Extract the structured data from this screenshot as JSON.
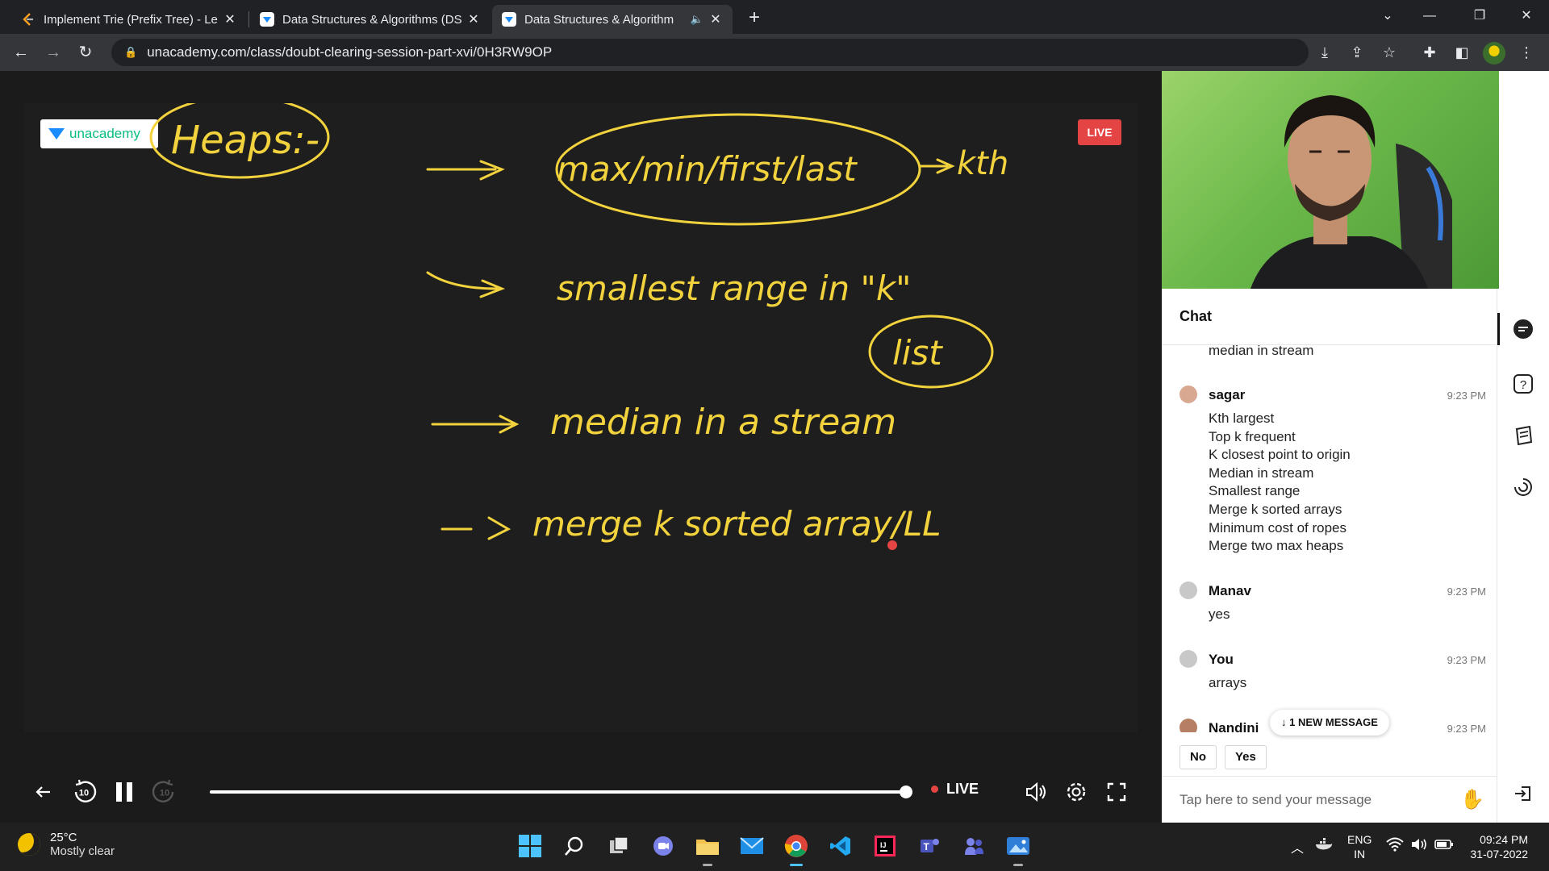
{
  "browser": {
    "tabs": [
      {
        "title": "Implement Trie (Prefix Tree) - Lee",
        "active": false
      },
      {
        "title": "Data Structures & Algorithms (DS",
        "active": false
      },
      {
        "title": "Data Structures & Algorithm",
        "active": true
      }
    ],
    "url": "unacademy.com/class/doubt-clearing-session-part-xvi/0H3RW9OP"
  },
  "player": {
    "brand": "unacademy",
    "live_badge": "LIVE",
    "live_label": "LIVE",
    "rewind_label": "10",
    "forward_label": "10",
    "progress": 1.0,
    "whiteboard_notes": [
      "Heaps:-",
      "max/min/first/last",
      "kth",
      "smallest range in \"k\"",
      "list",
      "median in a stream",
      "merge k sorted array/LL"
    ]
  },
  "chat": {
    "title": "Chat",
    "partial_top": "median in stream",
    "messages": [
      {
        "name": "sagar",
        "time": "9:23 PM",
        "lines": [
          "Kth largest",
          "Top k frequent",
          "K closest point to origin",
          "Median in stream",
          "Smallest range",
          "Merge k sorted arrays",
          "Minimum cost of ropes",
          "Merge two max heaps"
        ]
      },
      {
        "name": "Manav",
        "time": "9:23 PM",
        "lines": [
          "yes"
        ]
      },
      {
        "name": "You",
        "time": "9:23 PM",
        "lines": [
          "arrays"
        ]
      },
      {
        "name": "Nandini",
        "time": "9:23 PM",
        "lines": []
      }
    ],
    "new_message": "↓ 1 NEW MESSAGE",
    "poll": [
      "No",
      "Yes"
    ],
    "input_placeholder": "Tap here to send your message"
  },
  "taskbar": {
    "temperature": "25°C",
    "condition": "Mostly clear",
    "lang_1": "ENG",
    "lang_2": "IN",
    "time": "09:24 PM",
    "date": "31-07-2022"
  },
  "colors": {
    "ink": "#f2d33d",
    "live_red": "#e54444",
    "brand_green": "#08bd80",
    "brand_blue": "#1a8cff"
  }
}
